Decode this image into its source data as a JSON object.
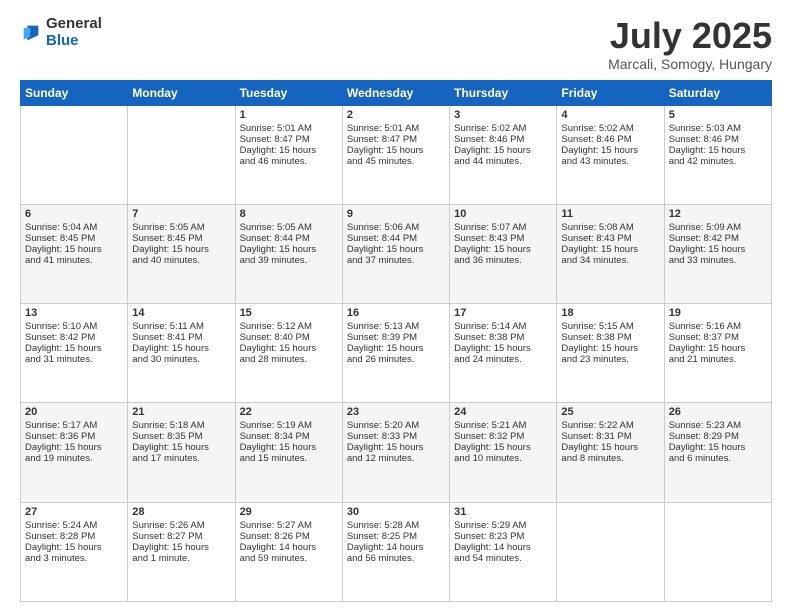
{
  "header": {
    "logo": {
      "general": "General",
      "blue": "Blue"
    },
    "title": "July 2025",
    "location": "Marcali, Somogy, Hungary"
  },
  "days_of_week": [
    "Sunday",
    "Monday",
    "Tuesday",
    "Wednesday",
    "Thursday",
    "Friday",
    "Saturday"
  ],
  "weeks": [
    [
      {
        "day": "",
        "empty": true
      },
      {
        "day": "",
        "empty": true
      },
      {
        "day": "1",
        "line1": "Sunrise: 5:01 AM",
        "line2": "Sunset: 8:47 PM",
        "line3": "Daylight: 15 hours",
        "line4": "and 46 minutes."
      },
      {
        "day": "2",
        "line1": "Sunrise: 5:01 AM",
        "line2": "Sunset: 8:47 PM",
        "line3": "Daylight: 15 hours",
        "line4": "and 45 minutes."
      },
      {
        "day": "3",
        "line1": "Sunrise: 5:02 AM",
        "line2": "Sunset: 8:46 PM",
        "line3": "Daylight: 15 hours",
        "line4": "and 44 minutes."
      },
      {
        "day": "4",
        "line1": "Sunrise: 5:02 AM",
        "line2": "Sunset: 8:46 PM",
        "line3": "Daylight: 15 hours",
        "line4": "and 43 minutes."
      },
      {
        "day": "5",
        "line1": "Sunrise: 5:03 AM",
        "line2": "Sunset: 8:46 PM",
        "line3": "Daylight: 15 hours",
        "line4": "and 42 minutes."
      }
    ],
    [
      {
        "day": "6",
        "line1": "Sunrise: 5:04 AM",
        "line2": "Sunset: 8:45 PM",
        "line3": "Daylight: 15 hours",
        "line4": "and 41 minutes."
      },
      {
        "day": "7",
        "line1": "Sunrise: 5:05 AM",
        "line2": "Sunset: 8:45 PM",
        "line3": "Daylight: 15 hours",
        "line4": "and 40 minutes."
      },
      {
        "day": "8",
        "line1": "Sunrise: 5:05 AM",
        "line2": "Sunset: 8:44 PM",
        "line3": "Daylight: 15 hours",
        "line4": "and 39 minutes."
      },
      {
        "day": "9",
        "line1": "Sunrise: 5:06 AM",
        "line2": "Sunset: 8:44 PM",
        "line3": "Daylight: 15 hours",
        "line4": "and 37 minutes."
      },
      {
        "day": "10",
        "line1": "Sunrise: 5:07 AM",
        "line2": "Sunset: 8:43 PM",
        "line3": "Daylight: 15 hours",
        "line4": "and 36 minutes."
      },
      {
        "day": "11",
        "line1": "Sunrise: 5:08 AM",
        "line2": "Sunset: 8:43 PM",
        "line3": "Daylight: 15 hours",
        "line4": "and 34 minutes."
      },
      {
        "day": "12",
        "line1": "Sunrise: 5:09 AM",
        "line2": "Sunset: 8:42 PM",
        "line3": "Daylight: 15 hours",
        "line4": "and 33 minutes."
      }
    ],
    [
      {
        "day": "13",
        "line1": "Sunrise: 5:10 AM",
        "line2": "Sunset: 8:42 PM",
        "line3": "Daylight: 15 hours",
        "line4": "and 31 minutes."
      },
      {
        "day": "14",
        "line1": "Sunrise: 5:11 AM",
        "line2": "Sunset: 8:41 PM",
        "line3": "Daylight: 15 hours",
        "line4": "and 30 minutes."
      },
      {
        "day": "15",
        "line1": "Sunrise: 5:12 AM",
        "line2": "Sunset: 8:40 PM",
        "line3": "Daylight: 15 hours",
        "line4": "and 28 minutes."
      },
      {
        "day": "16",
        "line1": "Sunrise: 5:13 AM",
        "line2": "Sunset: 8:39 PM",
        "line3": "Daylight: 15 hours",
        "line4": "and 26 minutes."
      },
      {
        "day": "17",
        "line1": "Sunrise: 5:14 AM",
        "line2": "Sunset: 8:38 PM",
        "line3": "Daylight: 15 hours",
        "line4": "and 24 minutes."
      },
      {
        "day": "18",
        "line1": "Sunrise: 5:15 AM",
        "line2": "Sunset: 8:38 PM",
        "line3": "Daylight: 15 hours",
        "line4": "and 23 minutes."
      },
      {
        "day": "19",
        "line1": "Sunrise: 5:16 AM",
        "line2": "Sunset: 8:37 PM",
        "line3": "Daylight: 15 hours",
        "line4": "and 21 minutes."
      }
    ],
    [
      {
        "day": "20",
        "line1": "Sunrise: 5:17 AM",
        "line2": "Sunset: 8:36 PM",
        "line3": "Daylight: 15 hours",
        "line4": "and 19 minutes."
      },
      {
        "day": "21",
        "line1": "Sunrise: 5:18 AM",
        "line2": "Sunset: 8:35 PM",
        "line3": "Daylight: 15 hours",
        "line4": "and 17 minutes."
      },
      {
        "day": "22",
        "line1": "Sunrise: 5:19 AM",
        "line2": "Sunset: 8:34 PM",
        "line3": "Daylight: 15 hours",
        "line4": "and 15 minutes."
      },
      {
        "day": "23",
        "line1": "Sunrise: 5:20 AM",
        "line2": "Sunset: 8:33 PM",
        "line3": "Daylight: 15 hours",
        "line4": "and 12 minutes."
      },
      {
        "day": "24",
        "line1": "Sunrise: 5:21 AM",
        "line2": "Sunset: 8:32 PM",
        "line3": "Daylight: 15 hours",
        "line4": "and 10 minutes."
      },
      {
        "day": "25",
        "line1": "Sunrise: 5:22 AM",
        "line2": "Sunset: 8:31 PM",
        "line3": "Daylight: 15 hours",
        "line4": "and 8 minutes."
      },
      {
        "day": "26",
        "line1": "Sunrise: 5:23 AM",
        "line2": "Sunset: 8:29 PM",
        "line3": "Daylight: 15 hours",
        "line4": "and 6 minutes."
      }
    ],
    [
      {
        "day": "27",
        "line1": "Sunrise: 5:24 AM",
        "line2": "Sunset: 8:28 PM",
        "line3": "Daylight: 15 hours",
        "line4": "and 3 minutes."
      },
      {
        "day": "28",
        "line1": "Sunrise: 5:26 AM",
        "line2": "Sunset: 8:27 PM",
        "line3": "Daylight: 15 hours",
        "line4": "and 1 minute."
      },
      {
        "day": "29",
        "line1": "Sunrise: 5:27 AM",
        "line2": "Sunset: 8:26 PM",
        "line3": "Daylight: 14 hours",
        "line4": "and 59 minutes."
      },
      {
        "day": "30",
        "line1": "Sunrise: 5:28 AM",
        "line2": "Sunset: 8:25 PM",
        "line3": "Daylight: 14 hours",
        "line4": "and 56 minutes."
      },
      {
        "day": "31",
        "line1": "Sunrise: 5:29 AM",
        "line2": "Sunset: 8:23 PM",
        "line3": "Daylight: 14 hours",
        "line4": "and 54 minutes."
      },
      {
        "day": "",
        "empty": true
      },
      {
        "day": "",
        "empty": true
      }
    ]
  ]
}
